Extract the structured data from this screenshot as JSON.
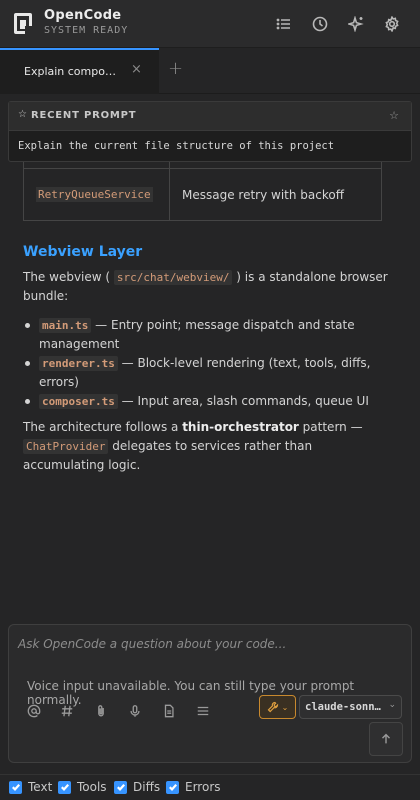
{
  "header": {
    "title": "OpenCode",
    "status": "SYSTEM READY",
    "icons": [
      "list-icon",
      "history-icon",
      "sparkle-icon",
      "settings-icon"
    ]
  },
  "tabs": [
    {
      "label": "Explain compo…",
      "close": "×",
      "active": true
    }
  ],
  "tab_add": "+",
  "recent_prompt": {
    "title": "RECENT PROMPT",
    "text": "Explain the current file structure of this project"
  },
  "content": {
    "table_row": {
      "name": "RetryQueueService",
      "description": "Message retry with backoff"
    },
    "heading": "Webview Layer",
    "intro_before": "The webview ( ",
    "intro_code": "src/chat/webview/",
    "intro_after": " ) is a standalone browser bundle:",
    "bullets": [
      {
        "code": "main.ts",
        "text": " — Entry point; message dispatch and state management"
      },
      {
        "code": "renderer.ts",
        "text": " — Block-level rendering (text, tools, diffs, errors)"
      },
      {
        "code": "composer.ts",
        "text": " — Input area, slash commands, queue UI"
      }
    ],
    "outro_before": "The architecture follows a ",
    "outro_bold": "thin-orchestrator",
    "outro_mid": " pattern — ",
    "outro_code": "ChatProvider",
    "outro_after": " delegates to services rather than accumulating logic."
  },
  "composer": {
    "placeholder": "Ask OpenCode a question about your code...",
    "voice_note": "Voice input unavailable. You can still type your prompt normally.",
    "tool_icons": [
      "at-icon",
      "hash-icon",
      "paperclip-icon",
      "microphone-icon",
      "file-icon",
      "queue-icon"
    ],
    "model": "claude-sonnet"
  },
  "filters": [
    {
      "label": "Text",
      "checked": true
    },
    {
      "label": "Tools",
      "checked": true
    },
    {
      "label": "Diffs",
      "checked": true
    },
    {
      "label": "Errors",
      "checked": true
    }
  ],
  "colors": {
    "accent": "#3794ff",
    "heading": "#3aa1ff",
    "code": "#d39b78",
    "warning": "#e0a040"
  }
}
